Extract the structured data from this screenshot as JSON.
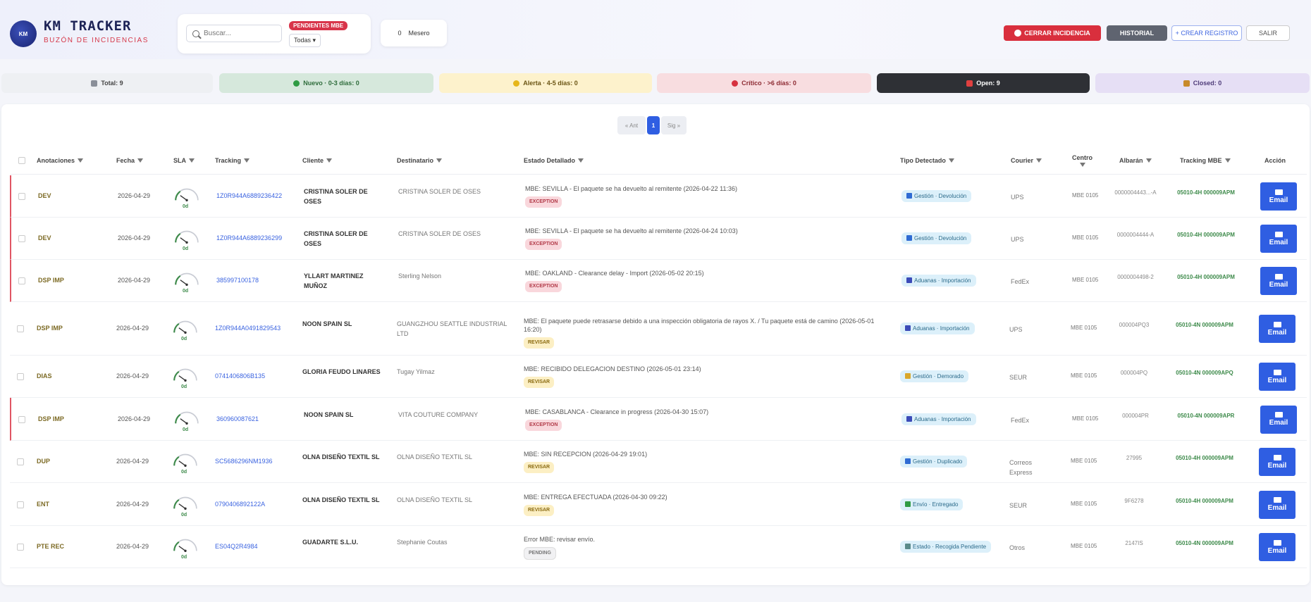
{
  "app": {
    "title": "KM TRACKER",
    "subtitle": "BUZÓN DE INCIDENCIAS",
    "logo_text": "KM"
  },
  "search": {
    "placeholder": "Buscar...",
    "pending_badge": "PENDIENTES MBE",
    "filter_value": "Todas"
  },
  "extra": {
    "left_label": "0",
    "right_label": "Mesero"
  },
  "header_buttons": {
    "close_incident": "CERRAR INCIDENCIA",
    "history": "HISTORIAL",
    "new": "+ CREAR REGISTRO",
    "exit": "SALIR"
  },
  "status_tabs": [
    {
      "label": "Total: 9",
      "color": "#8a8f99"
    },
    {
      "label": "Nuevo · 0-3 días: 0",
      "color": "#2f9b43"
    },
    {
      "label": "Alerta · 4-5 días: 0",
      "color": "#e6b619"
    },
    {
      "label": "Crítico · >6 días: 0",
      "color": "#d6313f"
    },
    {
      "label": "Open: 9",
      "color": "#e04040"
    },
    {
      "label": "Closed: 0",
      "color": "#c88a2a"
    }
  ],
  "pagination": {
    "prev": "« Ant",
    "current": "1",
    "next": "Sig »"
  },
  "columns": {
    "annotations": "Anotaciones",
    "date": "Fecha",
    "sla": "SLA",
    "tracking": "Tracking",
    "client": "Cliente",
    "recipient": "Destinatario",
    "status": "Estado Detallado",
    "type": "Tipo Detectado",
    "courier": "Courier",
    "center": "Centro",
    "albaran": "Albarán",
    "tracking_mbe": "Tracking MBE",
    "action": "Acción"
  },
  "email_label": "Email",
  "rows": [
    {
      "annot": "DEV",
      "date": "2026-04-29",
      "sla": "0d",
      "tracking": "1Z0R944A6889236422",
      "client": "CRISTINA SOLER DE OSES",
      "dest": "CRISTINA SOLER DE OSES",
      "estado": "MBE: SEVILLA - El paquete se ha devuelto al remitente (2026-04-22 11:36)",
      "pill": "EXCEPTION",
      "pill_kind": "exc",
      "tipo": "Gestión · Devolución",
      "tipo_color": "#2f6bd3",
      "courier": "UPS",
      "centro": "MBE 0105",
      "albaran": "0000004443...-A",
      "mbe": "05010-4H 000009APM",
      "exc": true
    },
    {
      "annot": "DEV",
      "date": "2026-04-29",
      "sla": "0d",
      "tracking": "1Z0R944A6889236299",
      "client": "CRISTINA SOLER DE OSES",
      "dest": "CRISTINA SOLER DE OSES",
      "estado": "MBE: SEVILLA - El paquete se ha devuelto al remitente (2026-04-24 10:03)",
      "pill": "EXCEPTION",
      "pill_kind": "exc",
      "tipo": "Gestión · Devolución",
      "tipo_color": "#2f6bd3",
      "courier": "UPS",
      "centro": "MBE 0105",
      "albaran": "0000004444-A",
      "mbe": "05010-4H 000009APM",
      "exc": true
    },
    {
      "annot": "DSP IMP",
      "date": "2026-04-29",
      "sla": "0d",
      "tracking": "385997100178",
      "client": "YLLART MARTINEZ MUÑOZ",
      "dest": "Sterling Nelson",
      "estado": "MBE: OAKLAND - Clearance delay - Import (2026-05-02 20:15)",
      "pill": "EXCEPTION",
      "pill_kind": "exc",
      "tipo": "Aduanas · Importación",
      "tipo_color": "#3b4bb8",
      "courier": "FedEx",
      "centro": "MBE 0105",
      "albaran": "0000004498-2",
      "mbe": "05010-4H 000009APM",
      "exc": true
    },
    {
      "annot": "DSP IMP",
      "date": "2026-04-29",
      "sla": "0d",
      "tracking": "1Z0R944A0491829543",
      "client": "NOON SPAIN SL",
      "dest": "GUANGZHOU SEATTLE INDUSTRIAL LTD",
      "estado": "MBE: El paquete puede retrasarse debido a una inspección obligatoria de rayos X. / Tu paquete está de camino (2026-05-01 16:20)",
      "pill": "REVISAR",
      "pill_kind": "rev",
      "tipo": "Aduanas · Importación",
      "tipo_color": "#3b4bb8",
      "courier": "UPS",
      "centro": "MBE 0105",
      "albaran": "000004PQ3",
      "mbe": "05010-4N 000009APM",
      "exc": false
    },
    {
      "annot": "DIAS",
      "date": "2026-04-29",
      "sla": "0d",
      "tracking": "0741406806B135",
      "client": "GLORIA FEUDO LINARES",
      "dest": "Tugay Yilmaz",
      "estado": "MBE: RECIBIDO DELEGACION DESTINO (2026-05-01 23:14)",
      "pill": "REVISAR",
      "pill_kind": "rev",
      "tipo": "Gestión · Demorado",
      "tipo_color": "#d9a72b",
      "courier": "SEUR",
      "centro": "MBE 0105",
      "albaran": "000004PQ",
      "mbe": "05010-4N 000009APQ",
      "exc": false
    },
    {
      "annot": "DSP IMP",
      "date": "2026-04-29",
      "sla": "0d",
      "tracking": "360960087621",
      "client": "NOON SPAIN SL",
      "dest": "VITA COUTURE COMPANY",
      "estado": "MBE: CASABLANCA - Clearance in progress (2026-04-30 15:07)",
      "pill": "EXCEPTION",
      "pill_kind": "exc",
      "tipo": "Aduanas · Importación",
      "tipo_color": "#3b4bb8",
      "courier": "FedEx",
      "centro": "MBE 0105",
      "albaran": "000004PR",
      "mbe": "05010-4N 000009APR",
      "exc": true
    },
    {
      "annot": "DUP",
      "date": "2026-04-29",
      "sla": "0d",
      "tracking": "SC5686296NM1936",
      "client": "OLNA DISEÑO TEXTIL SL",
      "dest": "OLNA DISEÑO TEXTIL SL",
      "estado": "MBE: SIN RECEPCION (2026-04-29 19:01)",
      "pill": "REVISAR",
      "pill_kind": "rev",
      "tipo": "Gestión · Duplicado",
      "tipo_color": "#2f6bd3",
      "courier": "Correos Express",
      "centro": "MBE 0105",
      "albaran": "27995",
      "mbe": "05010-4H 000009APM",
      "exc": false
    },
    {
      "annot": "ENT",
      "date": "2026-04-29",
      "sla": "0d",
      "tracking": "0790406892122A",
      "client": "OLNA DISEÑO TEXTIL SL",
      "dest": "OLNA DISEÑO TEXTIL SL",
      "estado": "MBE: ENTREGA EFECTUADA (2026-04-30 09:22)",
      "pill": "REVISAR",
      "pill_kind": "rev",
      "tipo": "Envío · Entregado",
      "tipo_color": "#2f9b43",
      "courier": "SEUR",
      "centro": "MBE 0105",
      "albaran": "9F6278",
      "mbe": "05010-4H 000009APM",
      "exc": false
    },
    {
      "annot": "PTE REC",
      "date": "2026-04-29",
      "sla": "0d",
      "tracking": "ES04Q2R4984",
      "client": "GUADARTE S.L.U.",
      "dest": "Stephanie Coutas",
      "estado": "Error MBE: revisar envío.",
      "pill": "PENDING",
      "pill_kind": "pend",
      "tipo": "Estado · Recogida Pendiente",
      "tipo_color": "#5a8a8a",
      "courier": "Otros",
      "centro": "MBE 0105",
      "albaran": "2147IS",
      "mbe": "05010-4N 000009APM",
      "exc": false
    }
  ]
}
